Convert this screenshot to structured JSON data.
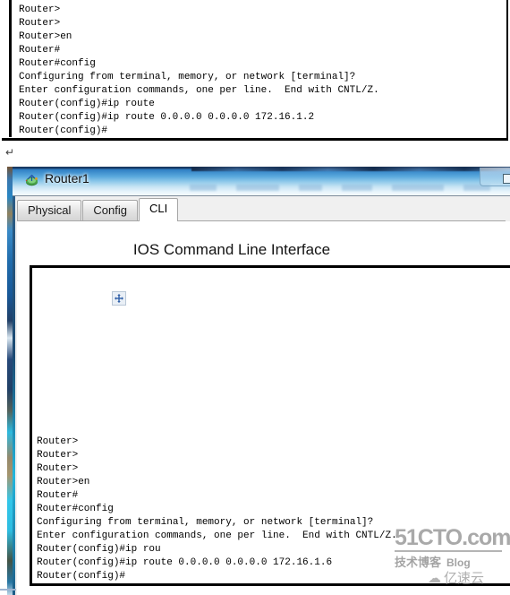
{
  "top_snippet": {
    "name": "cli-transcript-top",
    "lines": [
      "Router>",
      "Router>",
      "Router>en",
      "Router#",
      "Router#config",
      "Configuring from terminal, memory, or network [terminal]?",
      "Enter configuration commands, one per line.  End with CNTL/Z.",
      "Router(config)#ip route",
      "Router(config)#ip route 0.0.0.0 0.0.0.0 172.16.1.2",
      "Router(config)#"
    ]
  },
  "document": {
    "paragraph_mark": "↵"
  },
  "window": {
    "title": "Router1",
    "title_icon": "router-device-icon",
    "minimize_label": "",
    "tabs": [
      {
        "label": "Physical",
        "active": false
      },
      {
        "label": "Config",
        "active": false
      },
      {
        "label": "CLI",
        "active": true
      }
    ],
    "panel": {
      "heading": "IOS Command Line Interface",
      "cursor_icon": "move-cursor-icon",
      "cli_lines": [
        "Router>",
        "Router>",
        "Router>",
        "Router>en",
        "Router#",
        "Router#config",
        "Configuring from terminal, memory, or network [terminal]?",
        "Enter configuration commands, one per line.  End with CNTL/Z.",
        "Router(config)#ip rou",
        "Router(config)#ip route 0.0.0.0 0.0.0.0 172.16.1.6",
        "Router(config)#"
      ]
    }
  },
  "watermarks": {
    "primary": "51CTO.com",
    "secondary": "技术博客",
    "secondary_suffix": "Blog",
    "tertiary": "亿速云",
    "tertiary_icon": "cloud-icon"
  },
  "colors": {
    "titlebar_top": "#16355c",
    "titlebar_bottom": "#f4fbff",
    "terminal_text": "#000000",
    "terminal_bg": "#ffffff",
    "tab_active_bg": "#ffffff",
    "tab_inactive_bg": "#e2e2e2",
    "watermark_gray": "#9e9e9e"
  }
}
